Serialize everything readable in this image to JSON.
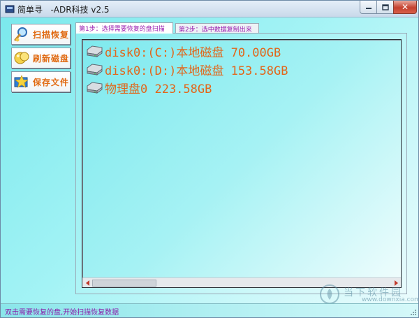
{
  "window": {
    "title": "简单寻   -ADR科技 v2.5"
  },
  "sidebar": {
    "buttons": [
      {
        "label": "扫描恢复",
        "icon": "magnifier-icon"
      },
      {
        "label": "刷新磁盘",
        "icon": "refresh-disk-icon"
      },
      {
        "label": "保存文件",
        "icon": "save-star-icon"
      }
    ]
  },
  "tabs": [
    {
      "label": "第1步：选择需要恢复的盘扫描",
      "active": true
    },
    {
      "label": "第2步：选中数据复制出来",
      "active": false
    }
  ],
  "disks": [
    {
      "label": "disk0:(C:)本地磁盘 70.00GB"
    },
    {
      "label": "disk0:(D:)本地磁盘 153.58GB"
    },
    {
      "label": "物理盘0 223.58GB"
    }
  ],
  "status": {
    "text": "双击需要恢复的盘,开始扫描恢复数据"
  },
  "watermark": {
    "cn": "当下软件园",
    "url": "www.downxia.com"
  },
  "colors": {
    "accent_text": "#e2661a",
    "tab_text": "#9a1fb0",
    "status_text": "#8a1aa8"
  }
}
